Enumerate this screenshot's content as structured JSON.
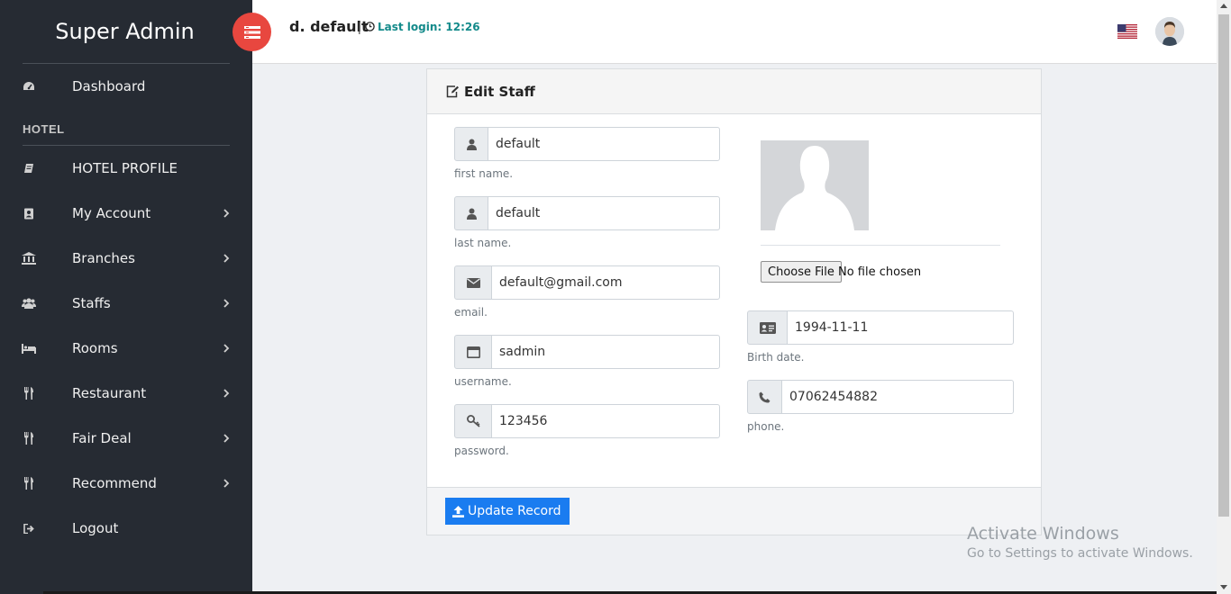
{
  "sidebar": {
    "brand": "Super Admin",
    "dashboard": {
      "label": "Dashboard",
      "icon": "dashboard-icon"
    },
    "section_title": "HOTEL",
    "items": [
      {
        "label": "HOTEL PROFILE",
        "icon": "book-icon",
        "has_submenu": false
      },
      {
        "label": "My Account",
        "icon": "address-book-icon",
        "has_submenu": true
      },
      {
        "label": "Branches",
        "icon": "bank-icon",
        "has_submenu": true
      },
      {
        "label": "Staffs",
        "icon": "users-icon",
        "has_submenu": true
      },
      {
        "label": "Rooms",
        "icon": "bed-icon",
        "has_submenu": true
      },
      {
        "label": "Restaurant",
        "icon": "cutlery-icon",
        "has_submenu": true
      },
      {
        "label": "Fair Deal",
        "icon": "cutlery-icon",
        "has_submenu": true
      },
      {
        "label": "Recommend",
        "icon": "cutlery-icon",
        "has_submenu": true
      },
      {
        "label": "Logout",
        "icon": "sign-out-icon",
        "has_submenu": false
      }
    ]
  },
  "topbar": {
    "user_name": "d. default",
    "separator": "|",
    "last_login": "Last login: 12:26",
    "flag": "us-flag-icon",
    "avatar": "user-avatar"
  },
  "form": {
    "title": "Edit Staff",
    "first_name": {
      "value": "default",
      "hint": "first name."
    },
    "last_name": {
      "value": "default",
      "hint": "last name."
    },
    "email": {
      "value": "default@gmail.com",
      "hint": "email."
    },
    "username": {
      "value": "sadmin",
      "hint": "username."
    },
    "password": {
      "value": "123456",
      "hint": "password."
    },
    "birth_date": {
      "value": "1994-11-11",
      "hint": "Birth date."
    },
    "phone": {
      "value": "07062454882",
      "hint": "phone."
    },
    "file_button": "Choose File",
    "file_status": "No file chosen",
    "submit_label": "Update Record"
  },
  "watermark": {
    "line1": "Activate Windows",
    "line2": "Go to Settings to activate Windows."
  },
  "colors": {
    "sidebar_bg": "#262b33",
    "toggle_red": "#e8473f",
    "primary_blue": "#1a7cf0",
    "login_teal": "#138a8a"
  }
}
